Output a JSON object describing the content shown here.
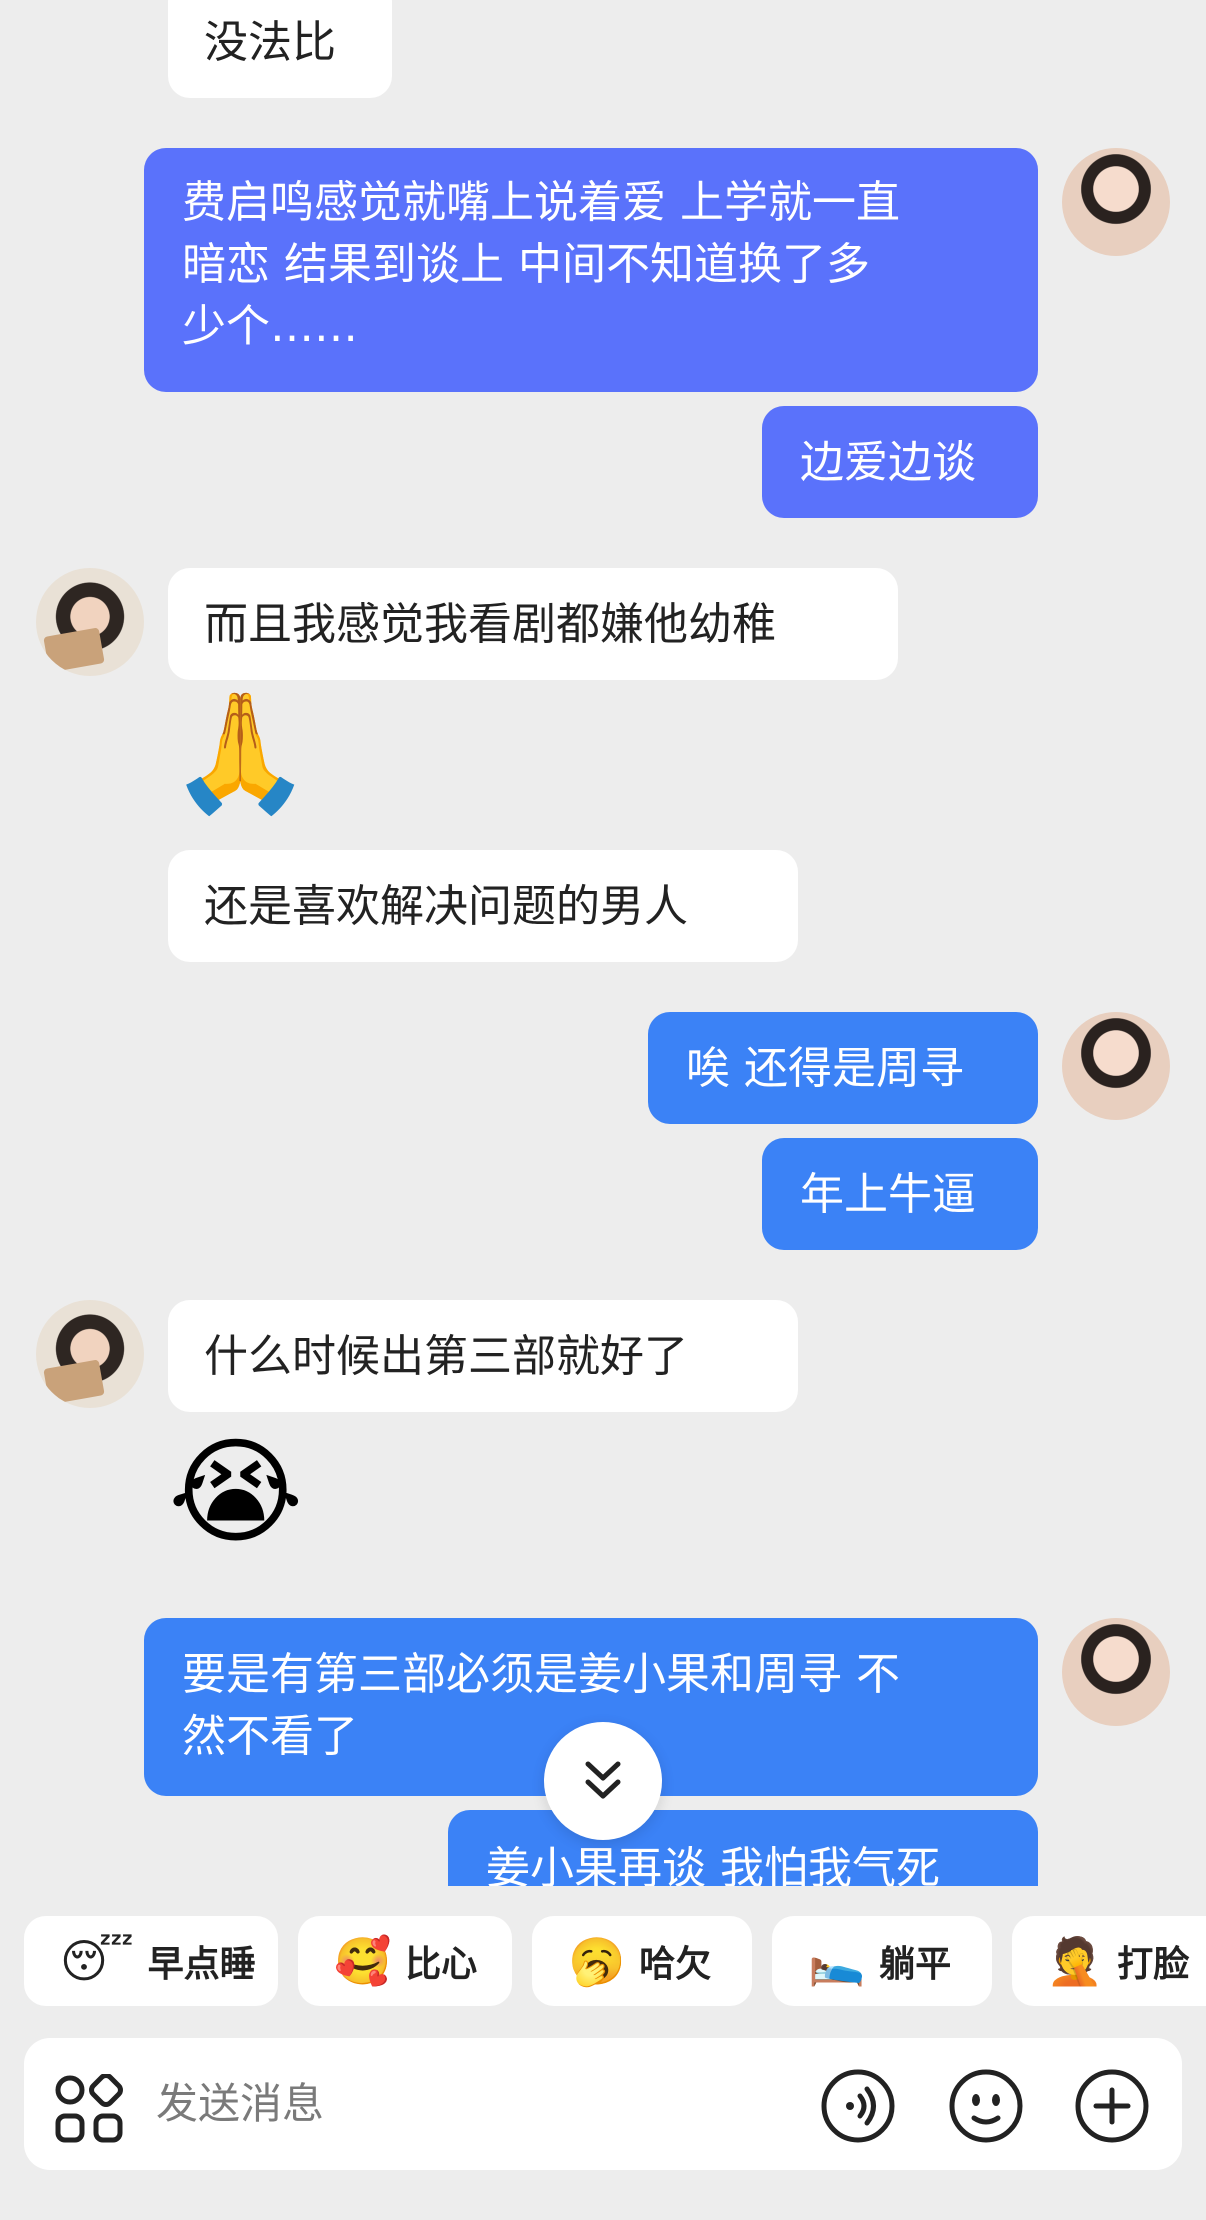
{
  "messages": [
    {
      "side": "left",
      "text": "没法比"
    },
    {
      "side": "right",
      "lines": [
        "费启鸣感觉就嘴上说着爱 上学就一直",
        "暗恋 结果到谈上 中间不知道换了多",
        "少个……"
      ]
    },
    {
      "side": "right",
      "text": "边爱边谈"
    },
    {
      "side": "left",
      "text": "而且我感觉我看剧都嫌他幼稚"
    },
    {
      "side": "left",
      "emoji": "🙏"
    },
    {
      "side": "left",
      "text": "还是喜欢解决问题的男人"
    },
    {
      "side": "right",
      "text": "唉 还得是周寻"
    },
    {
      "side": "right",
      "text": "年上牛逼"
    },
    {
      "side": "left",
      "text": "什么时候出第三部就好了"
    },
    {
      "side": "left",
      "emoji": "😭"
    },
    {
      "side": "right",
      "lines": [
        "要是有第三部必须是姜小果和周寻 不",
        "然不看了"
      ]
    },
    {
      "side": "right",
      "text": "姜小果再谈 我怕我气死"
    }
  ],
  "quick_replies": [
    {
      "icon": "😴",
      "label": "早点睡"
    },
    {
      "icon": "🥰",
      "label": "比心"
    },
    {
      "icon": "🥱",
      "label": "哈欠"
    },
    {
      "icon": "🛌",
      "label": "躺平"
    },
    {
      "icon": "🤦",
      "label": "打脸"
    }
  ],
  "input": {
    "placeholder": "发送消息"
  },
  "icons": {
    "apps": "apps-grid-icon",
    "voice": "voice-icon",
    "emoji": "emoji-face-icon",
    "plus": "plus-icon",
    "scroll": "chevron-double-down-icon"
  },
  "colors": {
    "self_bubble_purple": "#5a72fb",
    "self_bubble_blue": "#3b82f6",
    "other_bubble": "#ffffff",
    "background": "#ededed"
  }
}
